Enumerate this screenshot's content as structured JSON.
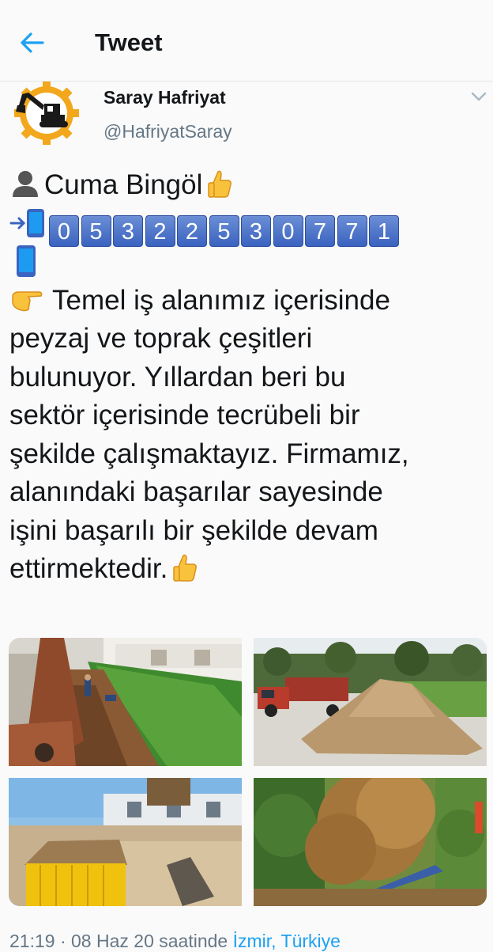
{
  "header": {
    "title": "Tweet",
    "back_icon": "arrow-left-icon",
    "accent": "#1da1f2"
  },
  "author": {
    "name": "Saray Hafriyat",
    "handle": "@HafriyatSaray",
    "avatar_icon": "excavator-gear-logo",
    "menu_icon": "chevron-down-icon"
  },
  "tweet": {
    "contact_name": "Cuma Bingöl",
    "phone_digits": [
      "0",
      "5",
      "3",
      "2",
      "2",
      "5",
      "3",
      "0",
      "7",
      "7",
      "1"
    ],
    "lines": [
      "Temel iş alanımız içerisinde",
      "peyzaj ve toprak çeşitleri",
      "bulunuyor. Yıllardan beri bu",
      "sektör içerisinde tecrübeli bir",
      "şekilde çalışmaktayız. Firmamız,",
      "alanındaki başarılar sayesinde",
      "işini başarılı bir şekilde devam",
      "ettirmektedir."
    ],
    "emojis": [
      "bust-in-silhouette",
      "thumbs-up",
      "phone-with-arrow",
      "mobile-phone",
      "pointing-hand",
      "thumbs-up"
    ]
  },
  "photos": [
    "excavator digging trench beside hedge and houses",
    "red truck beside large pile of soil",
    "yellow container filled with soil near buildings",
    "dense bushes beside a pipe"
  ],
  "footer": {
    "time": "21:19",
    "separator": " · ",
    "date_text": "08 Haz 20 saatinde",
    "location": "İzmir, Türkiye"
  }
}
